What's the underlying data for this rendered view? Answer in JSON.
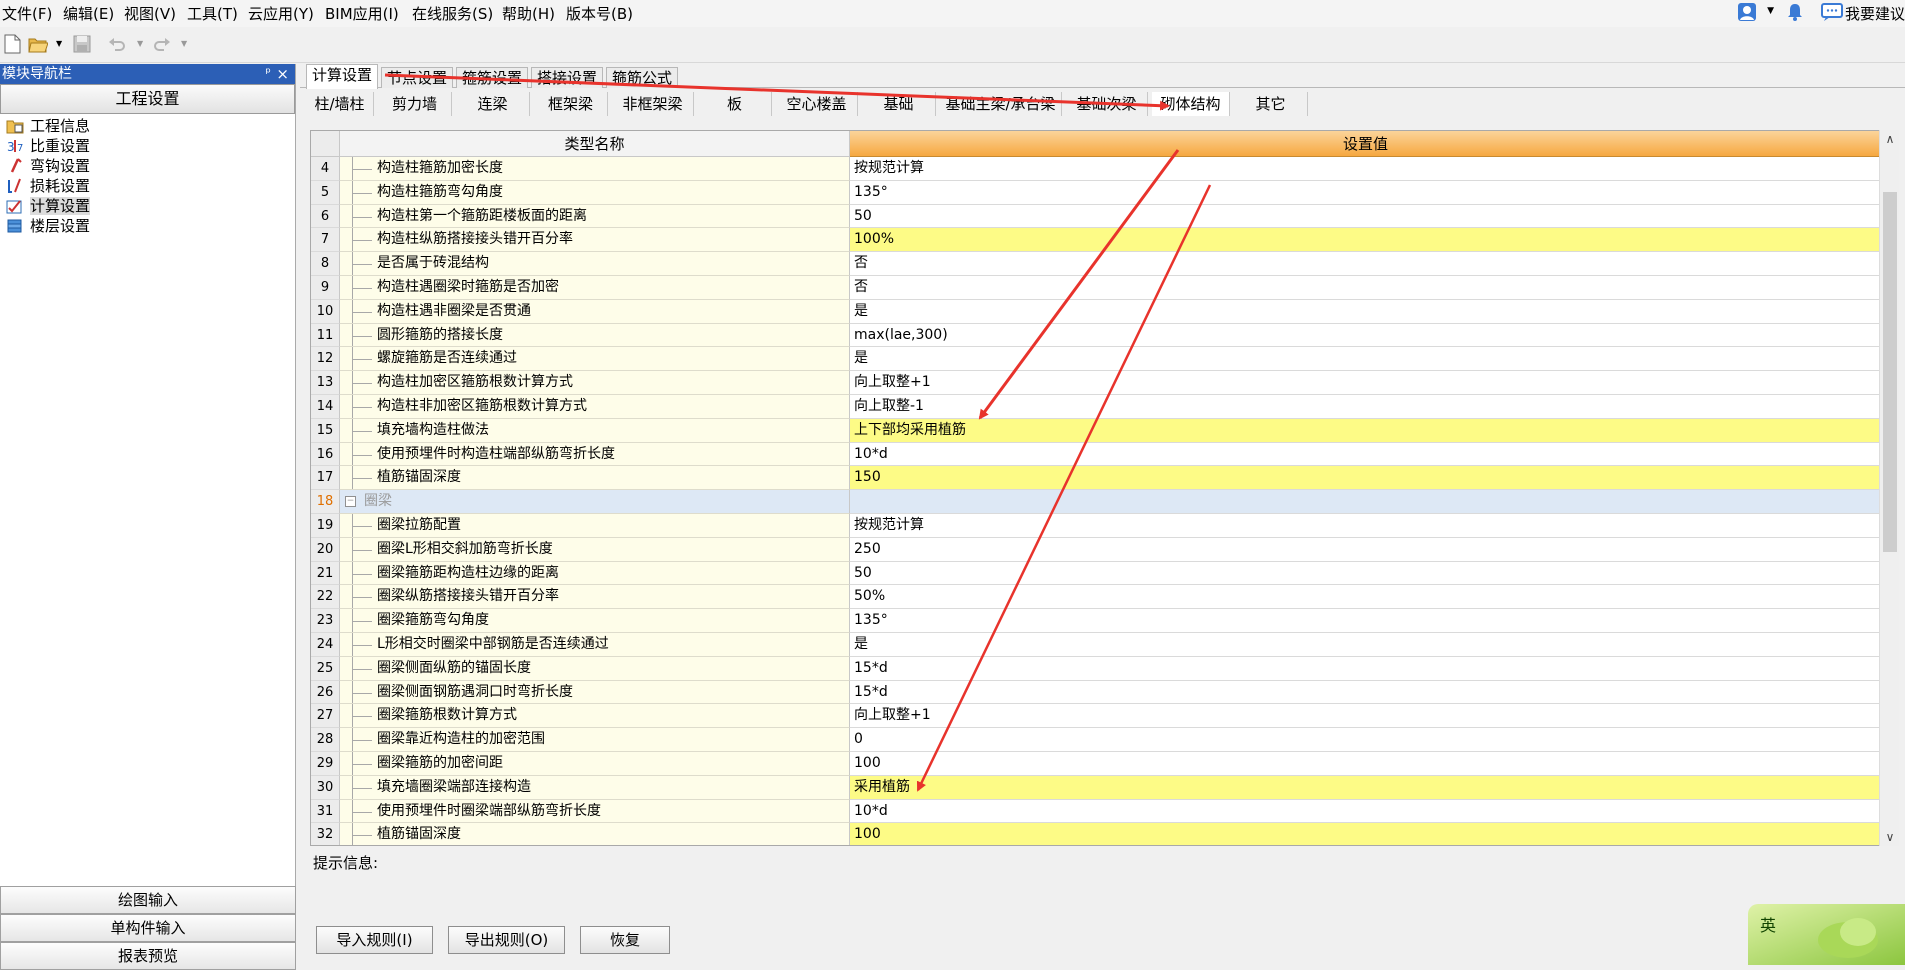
{
  "menubar": {
    "items": [
      "文件(F)",
      "编辑(E)",
      "视图(V)",
      "工具(T)",
      "云应用(Y)",
      "BIM应用(I)",
      "在线服务(S)",
      "帮助(H)",
      "版本号(B)"
    ],
    "suggest": "我要建议"
  },
  "toolbar": {
    "icons": [
      "new-file-icon",
      "open-folder-icon",
      "dropdown-icon",
      "save-icon",
      "undo-icon",
      "dropdown-icon",
      "redo-icon",
      "dropdown-icon"
    ]
  },
  "nav": {
    "title": "模块导航栏",
    "pin_glyph": "ᵖ",
    "close_glyph": "×",
    "section": "工程设置",
    "items": [
      {
        "label": "工程信息",
        "icon": "folder-info-icon"
      },
      {
        "label": "比重设置",
        "icon": "ratio-icon"
      },
      {
        "label": "弯钩设置",
        "icon": "hook-icon"
      },
      {
        "label": "损耗设置",
        "icon": "loss-icon"
      },
      {
        "label": "计算设置",
        "icon": "calc-settings-icon"
      },
      {
        "label": "楼层设置",
        "icon": "floors-icon"
      }
    ],
    "selected_index": 4,
    "bottom_buttons": [
      "绘图输入",
      "单构件输入",
      "报表预览"
    ]
  },
  "main_tabs": [
    "计算设置",
    "节点设置",
    "箍筋设置",
    "搭接设置",
    "箍筋公式"
  ],
  "active_main_tab": 0,
  "sub_tabs": [
    "柱/墙柱",
    "剪力墙",
    "连梁",
    "框架梁",
    "非框架梁",
    "板",
    "空心楼盖",
    "基础",
    "基础主梁/承台梁",
    "基础次梁",
    "砌体结构",
    "其它"
  ],
  "active_sub_tab": 10,
  "grid": {
    "col_name": "类型名称",
    "col_value": "设置值",
    "rows": [
      {
        "n": "4",
        "name": "构造柱箍筋加密长度",
        "value": "按规范计算",
        "hl": false
      },
      {
        "n": "5",
        "name": "构造柱箍筋弯勾角度",
        "value": "135°",
        "hl": false
      },
      {
        "n": "6",
        "name": "构造柱第一个箍筋距楼板面的距离",
        "value": "50",
        "hl": false
      },
      {
        "n": "7",
        "name": "构造柱纵筋搭接接头错开百分率",
        "value": "100%",
        "hl": true
      },
      {
        "n": "8",
        "name": "是否属于砖混结构",
        "value": "否",
        "hl": false
      },
      {
        "n": "9",
        "name": "构造柱遇圈梁时箍筋是否加密",
        "value": "否",
        "hl": false
      },
      {
        "n": "10",
        "name": "构造柱遇非圈梁是否贯通",
        "value": "是",
        "hl": false
      },
      {
        "n": "11",
        "name": "圆形箍筋的搭接长度",
        "value": "max(lae,300)",
        "hl": false
      },
      {
        "n": "12",
        "name": "螺旋箍筋是否连续通过",
        "value": "是",
        "hl": false
      },
      {
        "n": "13",
        "name": "构造柱加密区箍筋根数计算方式",
        "value": "向上取整+1",
        "hl": false
      },
      {
        "n": "14",
        "name": "构造柱非加密区箍筋根数计算方式",
        "value": "向上取整-1",
        "hl": false
      },
      {
        "n": "15",
        "name": "填充墙构造柱做法",
        "value": "上下部均采用植筋",
        "hl": true
      },
      {
        "n": "16",
        "name": "使用预埋件时构造柱端部纵筋弯折长度",
        "value": "10*d",
        "hl": false
      },
      {
        "n": "17",
        "name": "植筋锚固深度",
        "value": "150",
        "hl": true
      },
      {
        "n": "18",
        "name": "圈梁",
        "value": "",
        "group": true,
        "expander": "−"
      },
      {
        "n": "19",
        "name": "圈梁拉筋配置",
        "value": "按规范计算",
        "hl": false
      },
      {
        "n": "20",
        "name": "圈梁L形相交斜加筋弯折长度",
        "value": "250",
        "hl": false
      },
      {
        "n": "21",
        "name": "圈梁箍筋距构造柱边缘的距离",
        "value": "50",
        "hl": false
      },
      {
        "n": "22",
        "name": "圈梁纵筋搭接接头错开百分率",
        "value": "50%",
        "hl": false
      },
      {
        "n": "23",
        "name": "圈梁箍筋弯勾角度",
        "value": "135°",
        "hl": false
      },
      {
        "n": "24",
        "name": "L形相交时圈梁中部钢筋是否连续通过",
        "value": "是",
        "hl": false
      },
      {
        "n": "25",
        "name": "圈梁侧面纵筋的锚固长度",
        "value": "15*d",
        "hl": false
      },
      {
        "n": "26",
        "name": "圈梁侧面钢筋遇洞口时弯折长度",
        "value": "15*d",
        "hl": false
      },
      {
        "n": "27",
        "name": "圈梁箍筋根数计算方式",
        "value": "向上取整+1",
        "hl": false
      },
      {
        "n": "28",
        "name": "圈梁靠近构造柱的加密范围",
        "value": "0",
        "hl": false
      },
      {
        "n": "29",
        "name": "圈梁箍筋的加密间距",
        "value": "100",
        "hl": false
      },
      {
        "n": "30",
        "name": "填充墙圈梁端部连接构造",
        "value": "采用植筋",
        "hl": true
      },
      {
        "n": "31",
        "name": "使用预埋件时圈梁端部纵筋弯折长度",
        "value": "10*d",
        "hl": false
      },
      {
        "n": "32",
        "name": "植筋锚固深度",
        "value": "100",
        "hl": true
      }
    ]
  },
  "scrollbar": {
    "up": "∧",
    "down": "∨"
  },
  "hint_label": "提示信息:",
  "buttons": [
    "导入规则(I)",
    "导出规则(O)",
    "恢复"
  ],
  "ime": {
    "label": "英"
  },
  "colors": {
    "highlight": "#fdfb86",
    "header": "#f6a840",
    "name_bg": "#fefde9",
    "group_bg": "#dde8f5",
    "arrow": "#e8332c",
    "nav_header": "#2c5fb6"
  }
}
